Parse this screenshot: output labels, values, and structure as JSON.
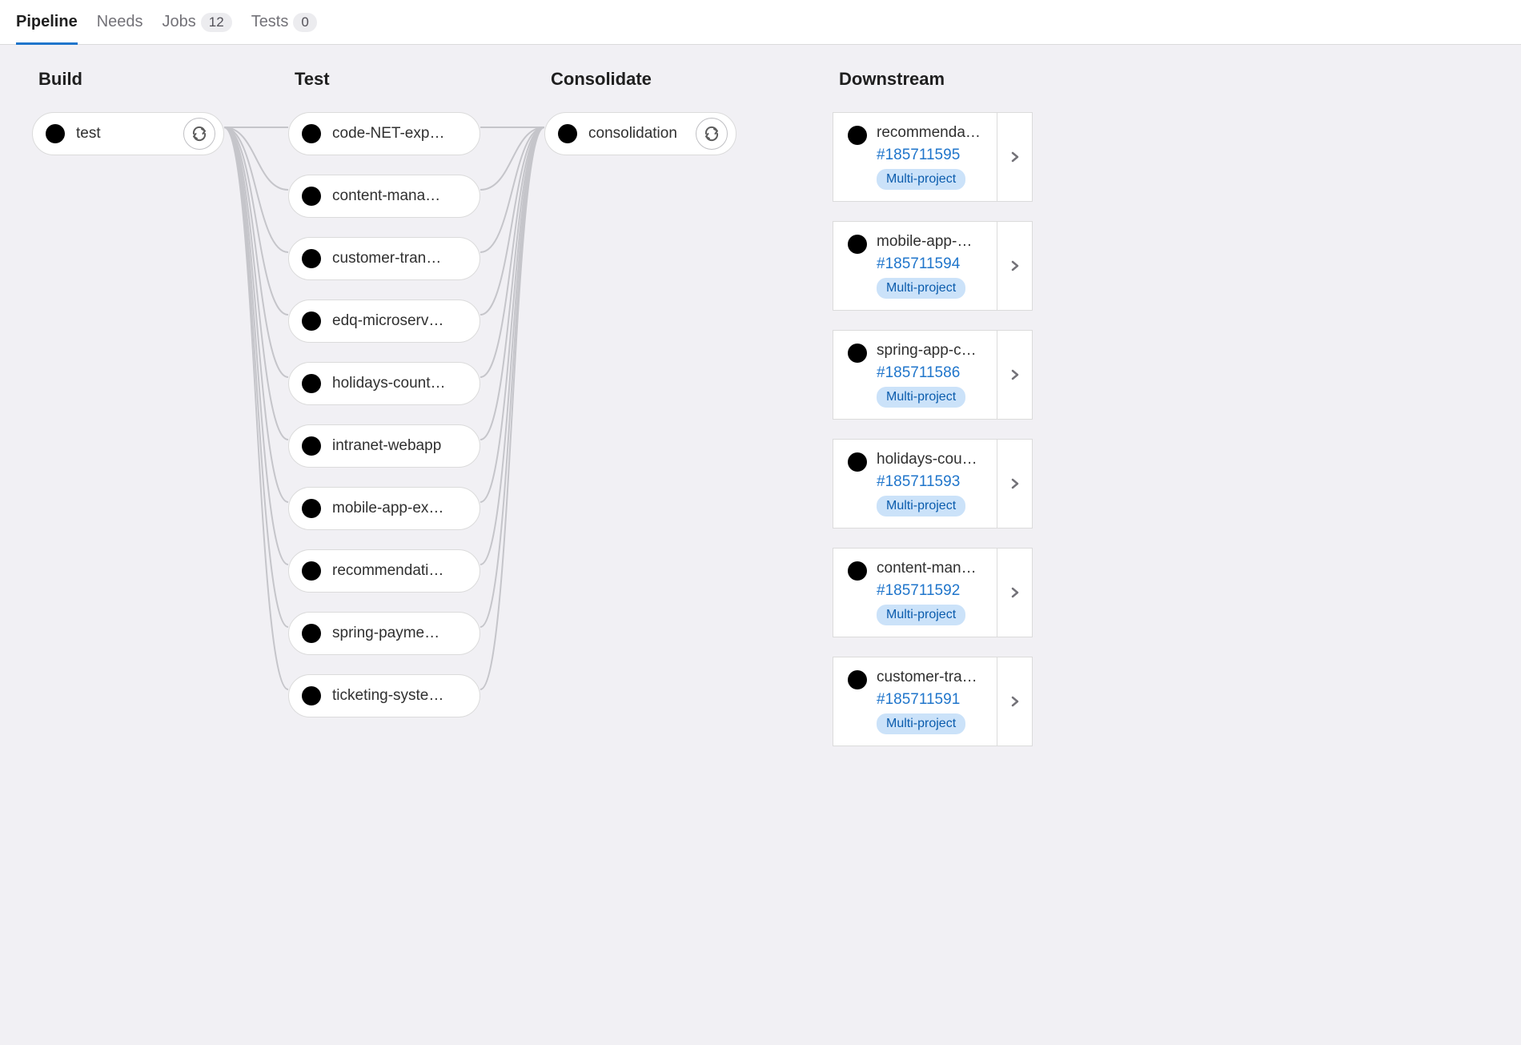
{
  "tabs": {
    "pipeline": "Pipeline",
    "needs": "Needs",
    "jobs": "Jobs",
    "jobs_count": "12",
    "tests": "Tests",
    "tests_count": "0"
  },
  "stages": {
    "build": {
      "title": "Build",
      "jobs": [
        {
          "name": "test",
          "status": "success",
          "retry": true
        }
      ]
    },
    "test": {
      "title": "Test",
      "jobs": [
        {
          "name": "code-NET-exp…",
          "status": "failed"
        },
        {
          "name": "content-mana…",
          "status": "failed"
        },
        {
          "name": "customer-tran…",
          "status": "success"
        },
        {
          "name": "edq-microserv…",
          "status": "failed"
        },
        {
          "name": "holidays-count…",
          "status": "success"
        },
        {
          "name": "intranet-webapp",
          "status": "success"
        },
        {
          "name": "mobile-app-ex…",
          "status": "success"
        },
        {
          "name": "recommendati…",
          "status": "failed"
        },
        {
          "name": "spring-payme…",
          "status": "success"
        },
        {
          "name": "ticketing-syste…",
          "status": "success"
        }
      ]
    },
    "consolidate": {
      "title": "Consolidate",
      "jobs": [
        {
          "name": "consolidation",
          "status": "success",
          "retry": true
        }
      ]
    },
    "downstream": {
      "title": "Downstream",
      "items": [
        {
          "name": "recommenda…",
          "id": "#185711595",
          "status": "failed",
          "badge": "Multi-project"
        },
        {
          "name": "mobile-app-…",
          "id": "#185711594",
          "status": "success",
          "badge": "Multi-project"
        },
        {
          "name": "spring-app-c…",
          "id": "#185711586",
          "status": "success",
          "badge": "Multi-project"
        },
        {
          "name": "holidays-cou…",
          "id": "#185711593",
          "status": "success",
          "badge": "Multi-project"
        },
        {
          "name": "content-man…",
          "id": "#185711592",
          "status": "failed",
          "badge": "Multi-project"
        },
        {
          "name": "customer-tra…",
          "id": "#185711591",
          "status": "success",
          "badge": "Multi-project"
        }
      ]
    }
  }
}
